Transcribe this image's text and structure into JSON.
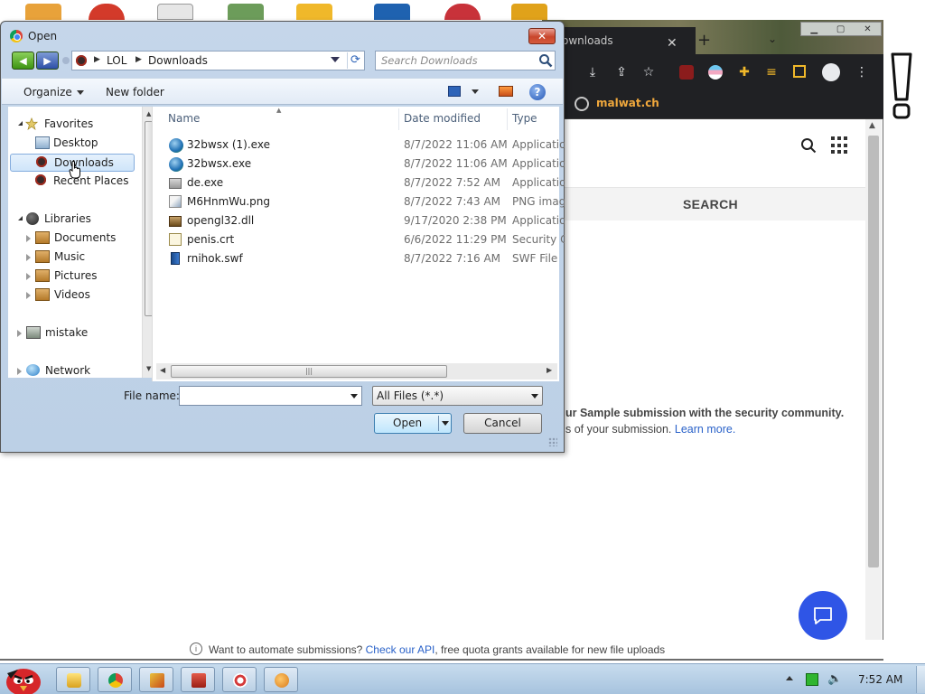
{
  "dialog": {
    "title": "Open",
    "address_crumbs": [
      "LOL",
      "Downloads"
    ],
    "search_placeholder": "Search Downloads",
    "organize_label": "Organize",
    "new_folder_label": "New folder",
    "nav_pane": {
      "favorites": "Favorites",
      "desktop": "Desktop",
      "downloads": "Downloads",
      "recent_places": "Recent Places",
      "libraries": "Libraries",
      "documents": "Documents",
      "music": "Music",
      "pictures": "Pictures",
      "videos": "Videos",
      "mistake": "mistake",
      "network": "Network"
    },
    "columns": {
      "name": "Name",
      "date_modified": "Date modified",
      "type": "Type"
    },
    "files": [
      {
        "name": "32bwsx (1).exe",
        "date": "8/7/2022 11:06 AM",
        "type": "Applicatio"
      },
      {
        "name": "32bwsx.exe",
        "date": "8/7/2022 11:06 AM",
        "type": "Applicatio"
      },
      {
        "name": "de.exe",
        "date": "8/7/2022 7:52 AM",
        "type": "Applicatio"
      },
      {
        "name": "M6HnmWu.png",
        "date": "8/7/2022 7:43 AM",
        "type": "PNG imag"
      },
      {
        "name": "opengl32.dll",
        "date": "9/17/2020 2:38 PM",
        "type": "Applicatio"
      },
      {
        "name": "penis.crt",
        "date": "6/6/2022 11:29 PM",
        "type": "Security C"
      },
      {
        "name": "rnihok.swf",
        "date": "8/7/2022 7:16 AM",
        "type": "SWF File"
      }
    ],
    "file_name_label": "File name:",
    "file_name_value": "",
    "filter_value": "All Files (*.*)",
    "open_label": "Open",
    "cancel_label": "Cancel"
  },
  "browser": {
    "tab_label": "ownloads",
    "bookmark_label": "malwat.ch",
    "search_label": "SEARCH",
    "share_text": "ur Sample submission with the security community.",
    "terms_prefix": "s of your submission. ",
    "learn_more": "Learn more.",
    "api_prefix": "Want to automate submissions? ",
    "api_link": "Check our API",
    "api_suffix": ", free quota grants available for new file uploads"
  },
  "taskbar": {
    "clock": "7:52 AM"
  },
  "colors": {
    "dialog_bg": "#c5d6ea",
    "accent_link": "#2a62c9",
    "chat_button": "#2f55e6",
    "bookmark_text": "#f0a83c"
  }
}
